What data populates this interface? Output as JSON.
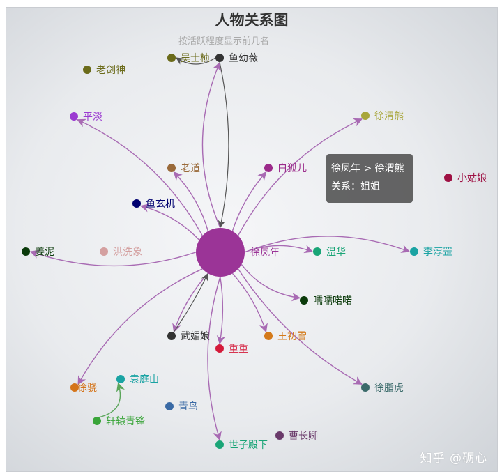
{
  "title": "人物关系图",
  "subtitle": "按活跃程度显示前几名",
  "watermark": "知乎 @砺心",
  "tooltip": {
    "line1": "徐凤年 > 徐渭熊",
    "line2": "关系：姐姐"
  },
  "colors": {
    "center": "#9b3497",
    "edge": "#a86ab3",
    "edge_dark": "#555555",
    "edge_green": "#5aa55a"
  },
  "center": {
    "name": "徐凤年",
    "color": "#9b3497"
  },
  "nodes": [
    {
      "id": "wushizhen",
      "name": "吴士桢",
      "color": "#6b6b1a"
    },
    {
      "id": "yuyouwei",
      "name": "鱼幼薇",
      "color": "#333333"
    },
    {
      "id": "laojianshen",
      "name": "老剑神",
      "color": "#6b6b1a"
    },
    {
      "id": "pingdan",
      "name": "平淡",
      "color": "#9b3ad1"
    },
    {
      "id": "xuweixiong",
      "name": "徐渭熊",
      "color": "#a8a63a"
    },
    {
      "id": "laodao",
      "name": "老道",
      "color": "#9a6a3a"
    },
    {
      "id": "baihuer",
      "name": "白狐儿",
      "color": "#9b2a8a"
    },
    {
      "id": "xiaoguniang",
      "name": "小姑娘",
      "color": "#9e1043"
    },
    {
      "id": "yuxuanji",
      "name": "鱼玄机",
      "color": "#000070"
    },
    {
      "id": "jiangni",
      "name": "姜泥",
      "color": "#0a3a0a"
    },
    {
      "id": "hongxixiang",
      "name": "洪洗象",
      "color": "#d4a0a0"
    },
    {
      "id": "wenhua",
      "name": "温华",
      "color": "#1aa577"
    },
    {
      "id": "lichungang",
      "name": "李淳罡",
      "color": "#1aa3a3"
    },
    {
      "id": "runruonuo",
      "name": "嚅嚅喏喏",
      "color": "#0a3a0a"
    },
    {
      "id": "wumeiniang",
      "name": "武媚娘",
      "color": "#333333"
    },
    {
      "id": "chongchong",
      "name": "重重",
      "color": "#d41a3a"
    },
    {
      "id": "wangchuxue",
      "name": "王初雪",
      "color": "#d47a1a"
    },
    {
      "id": "xuzhihu",
      "name": "徐脂虎",
      "color": "#3a6a6a"
    },
    {
      "id": "xuxiao",
      "name": "徐骁",
      "color": "#d4741a"
    },
    {
      "id": "yuantingshan",
      "name": "袁庭山",
      "color": "#1aa3a3"
    },
    {
      "id": "qingniao",
      "name": "青鸟",
      "color": "#3a6aa5"
    },
    {
      "id": "xuanyuan",
      "name": "轩辕青锋",
      "color": "#3aa53a"
    },
    {
      "id": "shizidianxia",
      "name": "世子殿下",
      "color": "#1aa577"
    },
    {
      "id": "caochangqing",
      "name": "曹长卿",
      "color": "#6a3a6a"
    }
  ],
  "edges": [
    {
      "from": "center",
      "to": "yuyouwei",
      "style": "purple"
    },
    {
      "from": "yuyouwei",
      "to": "center",
      "style": "dark"
    },
    {
      "from": "yuyouwei",
      "to": "wushizhen",
      "style": "dark"
    },
    {
      "from": "center",
      "to": "pingdan",
      "style": "purple"
    },
    {
      "from": "center",
      "to": "xuweixiong",
      "style": "purple"
    },
    {
      "from": "center",
      "to": "laodao",
      "style": "purple"
    },
    {
      "from": "center",
      "to": "baihuer",
      "style": "purple"
    },
    {
      "from": "center",
      "to": "yuxuanji",
      "style": "purple"
    },
    {
      "from": "center",
      "to": "jiangni",
      "style": "purple"
    },
    {
      "from": "center",
      "to": "wenhua",
      "style": "purple"
    },
    {
      "from": "center",
      "to": "lichungang",
      "style": "purple"
    },
    {
      "from": "center",
      "to": "runruonuo",
      "style": "purple"
    },
    {
      "from": "center",
      "to": "wumeiniang",
      "style": "purple"
    },
    {
      "from": "wumeiniang",
      "to": "center",
      "style": "dark"
    },
    {
      "from": "center",
      "to": "chongchong",
      "style": "purple"
    },
    {
      "from": "center",
      "to": "wangchuxue",
      "style": "purple"
    },
    {
      "from": "center",
      "to": "xuzhihu",
      "style": "purple"
    },
    {
      "from": "center",
      "to": "xuxiao",
      "style": "purple"
    },
    {
      "from": "center",
      "to": "shizidianxia",
      "style": "purple"
    },
    {
      "from": "xuanyuan",
      "to": "yuantingshan",
      "style": "green"
    }
  ]
}
